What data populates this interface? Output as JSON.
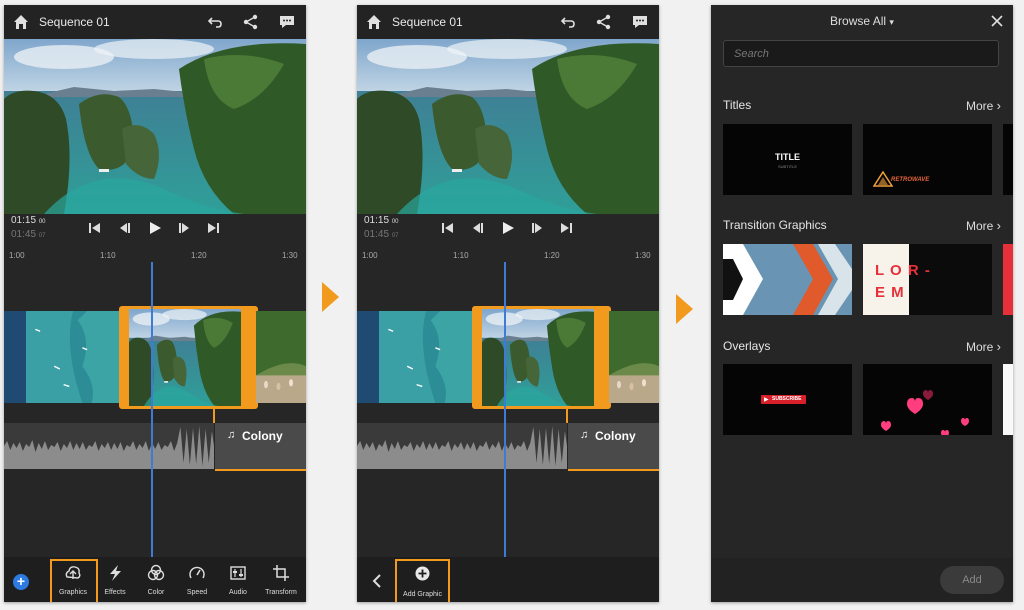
{
  "screen1": {
    "title": "Sequence 01",
    "timecode_current": "01:15",
    "timecode_current_frames": "00",
    "timecode_total": "01:45",
    "timecode_total_frames": "07",
    "ruler_ticks": [
      "1:00",
      "1:10",
      "1:20",
      "1:30"
    ],
    "audio_clip": "Colony",
    "tools": [
      "Graphics",
      "Effects",
      "Color",
      "Speed",
      "Audio",
      "Transform"
    ],
    "highlighted_tool": "Graphics"
  },
  "screen2": {
    "title": "Sequence 01",
    "timecode_current": "01:15",
    "timecode_current_frames": "00",
    "timecode_total": "01:45",
    "timecode_total_frames": "07",
    "ruler_ticks": [
      "1:00",
      "1:10",
      "1:20",
      "1:30"
    ],
    "audio_clip": "Colony",
    "add_graphic_label": "Add Graphic"
  },
  "screen3": {
    "title": "Browse All",
    "search_placeholder": "Search",
    "sections": [
      {
        "title": "Titles",
        "more": "More"
      },
      {
        "title": "Transition Graphics",
        "more": "More"
      },
      {
        "title": "Overlays",
        "more": "More"
      }
    ],
    "title_thumb_text": "TITLE",
    "title_thumb_sub": "SUBTITLE",
    "retro_thumb_text": "RETROWAVE",
    "lorem_line1": "L O R -",
    "lorem_line2": "E M",
    "subscribe_text": "SUBSCRIBE",
    "add_label": "Add"
  },
  "colors": {
    "accent": "#f29a1e",
    "playhead": "#3d7bd6",
    "panel": "#262626"
  }
}
